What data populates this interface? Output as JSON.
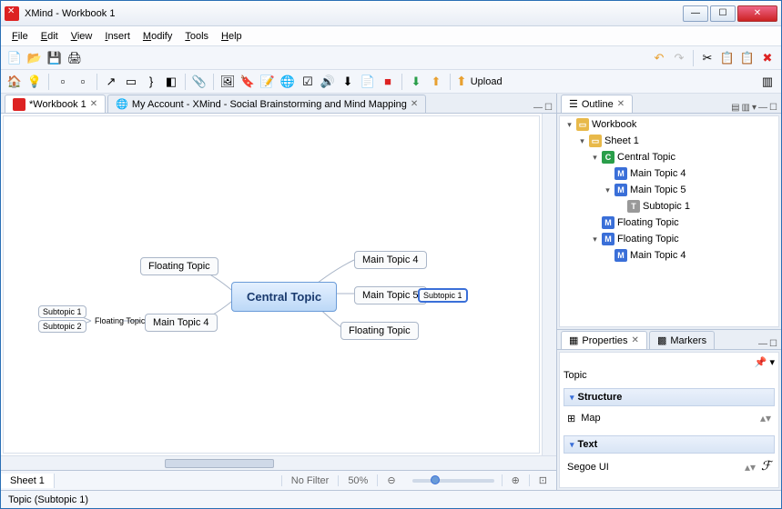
{
  "window": {
    "title": "XMind - Workbook 1"
  },
  "menu": {
    "file": "File",
    "edit": "Edit",
    "view": "View",
    "insert": "Insert",
    "modify": "Modify",
    "tools": "Tools",
    "help": "Help"
  },
  "toolbar2": {
    "upload": "Upload"
  },
  "tabs": {
    "workbook": "*Workbook 1",
    "browser": "My Account - XMind - Social Brainstorming and Mind Mapping"
  },
  "mindmap": {
    "central": "Central Topic",
    "mt4": "Main Topic 4",
    "mt5": "Main Topic 5",
    "mt4b": "Main Topic 4",
    "ft1": "Floating Topic",
    "ft2": "Floating Topic",
    "ft3": "Floating Topic",
    "sub1": "Subtopic 1",
    "sub1b": "Subtopic 1",
    "sub2": "Subtopic 2"
  },
  "bottom": {
    "sheet": "Sheet 1",
    "filter": "No Filter",
    "zoom": "50%"
  },
  "outline": {
    "title": "Outline",
    "tree": {
      "wb": "Workbook",
      "sheet": "Sheet 1",
      "central": "Central Topic",
      "mt4": "Main Topic 4",
      "mt5": "Main Topic 5",
      "sub1": "Subtopic 1",
      "ft1": "Floating Topic",
      "ft2": "Floating Topic",
      "mt4b": "Main Topic 4"
    }
  },
  "props": {
    "tab1": "Properties",
    "tab2": "Markers",
    "topic": "Topic",
    "structure": "Structure",
    "structure_val": "Map",
    "text": "Text",
    "font": "Segoe UI"
  },
  "status": {
    "text": "Topic (Subtopic 1)"
  }
}
